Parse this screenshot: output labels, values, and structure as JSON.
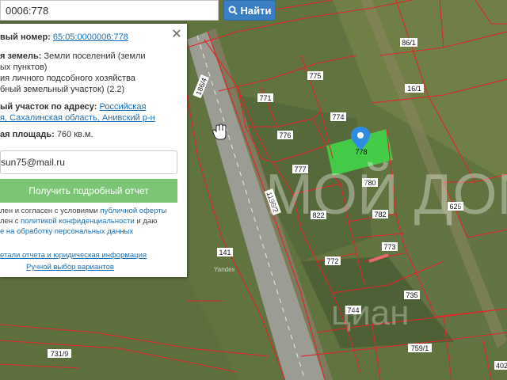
{
  "search": {
    "value": "0006:778",
    "button_label": "Найти"
  },
  "panel": {
    "cadastral_label": "вый номер:",
    "cadastral_value": "65:05:0000006:778",
    "category_label": "я земель:",
    "category_value_1": "Земли поселений (земли",
    "category_value_2": "ых пунктов)",
    "usage_1": "ия личного подсобного хозяйства",
    "usage_2": "бный земельный участок) (2.2)",
    "address_label": "ый участок по адресу:",
    "address_1": "Российская",
    "address_2": "я, Сахалинская область, Анивский р-н",
    "area_label": "ая площадь:",
    "area_value": "760 кв.м.",
    "email_value": "sun75@mail.ru",
    "report_button": "Получить подробный отчет",
    "consent_1a": "лен и согласен с условиями ",
    "consent_1b": "публичной оферты",
    "consent_2a": "лен с ",
    "consent_2b": "политикой конфиденциальности",
    "consent_2c": " и даю",
    "consent_3": "е на обработку персональных данных",
    "details_link": "етали отчета и юридическая информация",
    "manual_link": "Ручной выбор вариантов"
  },
  "map": {
    "parcels": [
      "86/1",
      "775",
      "16/1",
      "771",
      "774",
      "776",
      "778",
      "777",
      "780",
      "625",
      "822",
      "782",
      "773",
      "141",
      "772",
      "735",
      "744",
      "731/9",
      "759/1",
      "402",
      "186/4",
      "1196/2"
    ],
    "watermark": "МОЙ ДОМ",
    "watermark_2": "циан",
    "attribution": "Yandex",
    "colors": {
      "parcel_line": "#e0262a",
      "selected_fill": "#3fdc4a",
      "pin": "#2e8de0"
    }
  }
}
